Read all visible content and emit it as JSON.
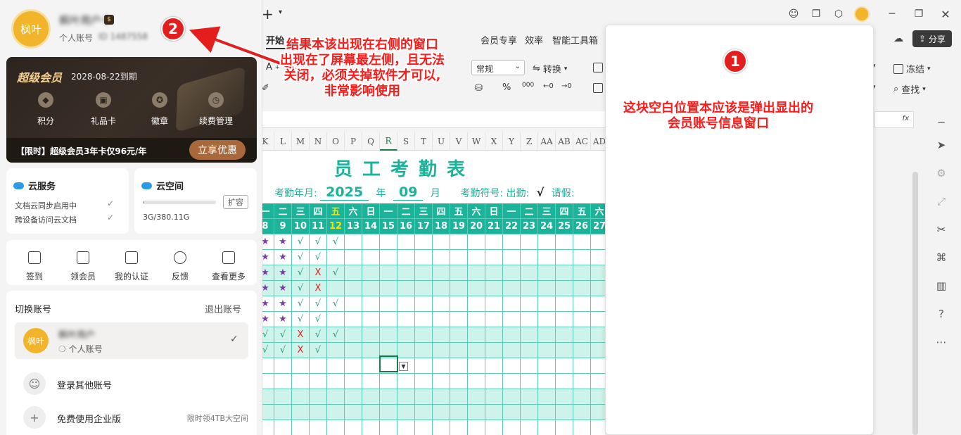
{
  "titlebar": {
    "new_tab_plus": "+",
    "window_controls": [
      "minimize",
      "maximize",
      "close"
    ]
  },
  "ribbon": {
    "tabs": [
      "开始",
      "会员专享",
      "效率",
      "智能工具箱"
    ],
    "active_tab": "开始",
    "share_label": "分享",
    "number_format": "常规",
    "convert_label": "转换",
    "freeze_label": "冻结",
    "find_label": "查找",
    "percent": "%",
    "thousands": "000"
  },
  "formula_bar": {
    "fx": "fx"
  },
  "sheet": {
    "columns": [
      "K",
      "L",
      "M",
      "N",
      "O",
      "P",
      "Q",
      "R",
      "S",
      "T",
      "U",
      "V",
      "W",
      "X",
      "Y",
      "Z",
      "AA",
      "AB",
      "AC",
      "AD"
    ],
    "selected_column": "R",
    "title": "员工考勤表",
    "year_label": "考勤年月:",
    "year": "2025",
    "year_unit": "年",
    "month": "09",
    "month_unit": "月",
    "symbol_label": "考勤符号:",
    "attend_label": "出勤:",
    "attend_symbol": "√",
    "leave_label": "请假:",
    "weekdays": [
      "一",
      "二",
      "三",
      "四",
      "五",
      "六",
      "日",
      "一",
      "二",
      "三",
      "四",
      "五",
      "六",
      "日",
      "一",
      "二",
      "三",
      "四",
      "五",
      "六"
    ],
    "days": [
      "8",
      "9",
      "10",
      "11",
      "12",
      "13",
      "14",
      "15",
      "16",
      "17",
      "18",
      "19",
      "20",
      "21",
      "22",
      "23",
      "24",
      "25",
      "26",
      "27"
    ],
    "highlight_index": 4,
    "rows": [
      [
        "★",
        "★",
        "√",
        "√",
        "√"
      ],
      [
        "★",
        "★",
        "√",
        "√",
        ""
      ],
      [
        "★",
        "★",
        "√",
        "X",
        "√"
      ],
      [
        "★",
        "★",
        "√",
        "X",
        ""
      ],
      [
        "★",
        "★",
        "√",
        "√",
        "√"
      ],
      [
        "★",
        "★",
        "√",
        "√",
        ""
      ],
      [
        "√",
        "√",
        "X",
        "√",
        "√"
      ],
      [
        "√",
        "√",
        "X",
        "√",
        ""
      ]
    ],
    "colors": {
      "header_bg": "#1bb39a",
      "row_alt": "#cdf3ea",
      "grid": "#5ccbb7",
      "star": "#7a3ca8",
      "check": "#19a070",
      "cross": "#e02020"
    }
  },
  "account_panel": {
    "avatar_text": "枫叶",
    "user_name": "枫叶用户十",
    "account_type": "个人账号",
    "account_id": "ID 1487558",
    "vip": {
      "title": "超级会员",
      "expire": "2028-08-22到期",
      "items": [
        "积分",
        "礼品卡",
        "徽章",
        "续费管理"
      ],
      "promo_text": "【限时】超级会员3年卡仅96元/年",
      "promo_button": "立享优惠"
    },
    "cloud_service": {
      "title": "云服务",
      "lines": [
        "文档云同步启用中",
        "跨设备访问云文档"
      ]
    },
    "cloud_space": {
      "title": "云空间",
      "usage": "3G/380.11G",
      "usage_fraction": 0.008,
      "expand": "扩容"
    },
    "quick_actions": [
      "签到",
      "领会员",
      "我的认证",
      "反馈",
      "查看更多"
    ],
    "switch": {
      "title": "切换账号",
      "logout": "退出账号",
      "current_name": "枫叶用户",
      "current_type": "个人账号",
      "login_other": "登录其他账号",
      "enterprise": "免费使用企业版",
      "enterprise_note": "限时领4TB大空间"
    }
  },
  "annotations": {
    "marker1": "1",
    "marker2": "2",
    "text1_line1": "这块空白位置本应该是弹出显出的",
    "text1_line2": "会员账号信息窗口",
    "text2_line1": "结果本该出现在右侧的窗口",
    "text2_line2": "出现在了屏幕最左侧，且无法",
    "text2_line3": "关闭，必须关掉软件才可以,",
    "text2_line4": "非常影响使用",
    "color": "#e41d1d"
  }
}
